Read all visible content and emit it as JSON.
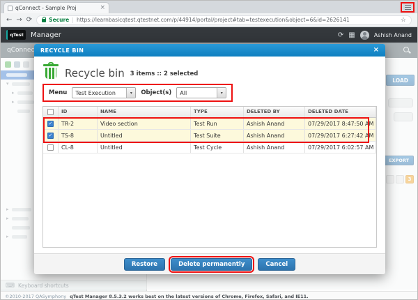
{
  "browser": {
    "tab_title": "qConnect - Sample Proj",
    "tab_close": "×",
    "back_icon": "←",
    "forward_icon": "→",
    "refresh_icon": "⟳",
    "secure_label": "Secure",
    "url": "https://learnbasicqtest.qtestnet.com/p/44914/portal/project#tab=testexecution&object=6&id=2626141",
    "star_icon": "☆"
  },
  "app": {
    "logo": "qTest",
    "product": "Manager",
    "refresh_icon": "⟳",
    "grid_icon": "▦",
    "user_name": "Ashish Anand",
    "page_title": "qConnect -"
  },
  "background": {
    "upload_button": "LOAD",
    "export_button": "EXPORT",
    "active_page": "3",
    "keyboard_icon": "⌨",
    "keyboard_shortcuts": "Keyboard shortcuts"
  },
  "modal": {
    "header": "RECYCLE BIN",
    "close": "×",
    "title": "Recycle bin",
    "summary": "3 items :: 2 selected",
    "filters": {
      "menu_label": "Menu",
      "menu_value": "Test Execution",
      "objects_label": "Object(s)",
      "objects_value": "All",
      "arrow": "▾"
    },
    "table": {
      "col_id": "ID",
      "col_name": "NAME",
      "col_type": "TYPE",
      "col_deleted_by": "DELETED BY",
      "col_deleted_date": "DELETED DATE",
      "rows": [
        {
          "selected": true,
          "id": "TR-2",
          "name": "Video section",
          "type": "Test Run",
          "deleted_by": "Ashish Anand",
          "deleted_date": "07/29/2017 8:47:50 AM"
        },
        {
          "selected": true,
          "id": "TS-8",
          "name": "Untitled",
          "type": "Test Suite",
          "deleted_by": "Ashish Anand",
          "deleted_date": "07/29/2017 6:27:42 AM"
        },
        {
          "selected": false,
          "id": "CL-8",
          "name": "Untitled",
          "type": "Test Cycle",
          "deleted_by": "Ashish Anand",
          "deleted_date": "07/29/2017 6:02:57 AM"
        }
      ]
    },
    "buttons": {
      "restore": "Restore",
      "delete": "Delete permanently",
      "cancel": "Cancel"
    }
  },
  "statusbar": {
    "copyright": "©2010-2017 QASymphony",
    "info": "qTest Manager 8.5.3.2 works best on the latest versions of Chrome, Firefox, Safari, and IE11."
  },
  "colors": {
    "modal_header_blue": "#0e7fc0",
    "button_blue": "#2d74ae",
    "annotation_red": "#ee1111",
    "selected_row_yellow": "#fdf9dc",
    "active_page_orange": "#f5a728",
    "secure_green": "#0b8043",
    "recycle_green": "#3aaa35"
  }
}
